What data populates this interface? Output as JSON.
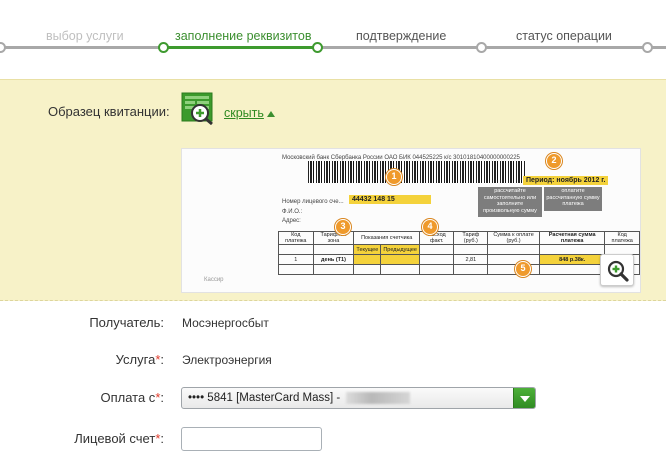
{
  "steps": [
    {
      "label": "выбор услуги",
      "state": "done"
    },
    {
      "label": "заполнение реквизитов",
      "state": "active"
    },
    {
      "label": "подтверждение",
      "state": "todo"
    },
    {
      "label": "статус операции",
      "state": "todo"
    }
  ],
  "colors": {
    "accent": "#3e9a2f",
    "panel_bg": "#f7f2c8",
    "required": "#e03a2a",
    "badge": "#ef9a2c",
    "highlight": "#f4d23b"
  },
  "sample": {
    "label": "Образец квитанции:",
    "hide_link": "скрыть",
    "icon": "receipt-zoom-icon",
    "receipt": {
      "bank_line": "Московский банк Сбербанка России ОАО БИК 044525225 к/с 30101810400000000225",
      "period_label": "Период:",
      "period_value": "ноябрь 2012 г.",
      "account_label": "Номер лицевого сче...",
      "account_value": "44432   148   15",
      "fio_label": "Ф.И.О.:",
      "address_label": "Адрес:",
      "note_left": "рассчитайте самостоятельно или заполните произвольную сумму",
      "note_right": "оплатите рассчитанную сумму платежа",
      "col_code": "Код платежа",
      "col_tariff_zone": "Тарифная зона",
      "col_meter": "Показания счетчика",
      "col_current": "Текущее",
      "col_previous": "Предыдущее",
      "col_consumption": "Расход факт.",
      "col_tariff": "Тариф (руб.)",
      "col_sum": "Сумма к оплате (руб.)",
      "col_calc": "Расчетная сумма платежа",
      "col_code2": "Код платежа",
      "row_code": "1",
      "row_zone": "день (Т1)",
      "row_tariff": "2,81",
      "calc_value": "848 р.38к.",
      "cashier": "Кассир",
      "badges": [
        "1",
        "2",
        "3",
        "4",
        "5"
      ]
    },
    "zoom_icon": "magnifier-plus-icon"
  },
  "form": {
    "recipient_label": "Получатель:",
    "recipient_value": "Мосэнергосбыт",
    "service_label": "Услуга",
    "service_value": "Электроэнергия",
    "pay_from_label": "Оплата с",
    "pay_from_value": "•••• 5841 [MasterCard Mass] -",
    "account_label": "Лицевой счет",
    "account_value": "",
    "required_mark": "*",
    "colon": ":"
  }
}
